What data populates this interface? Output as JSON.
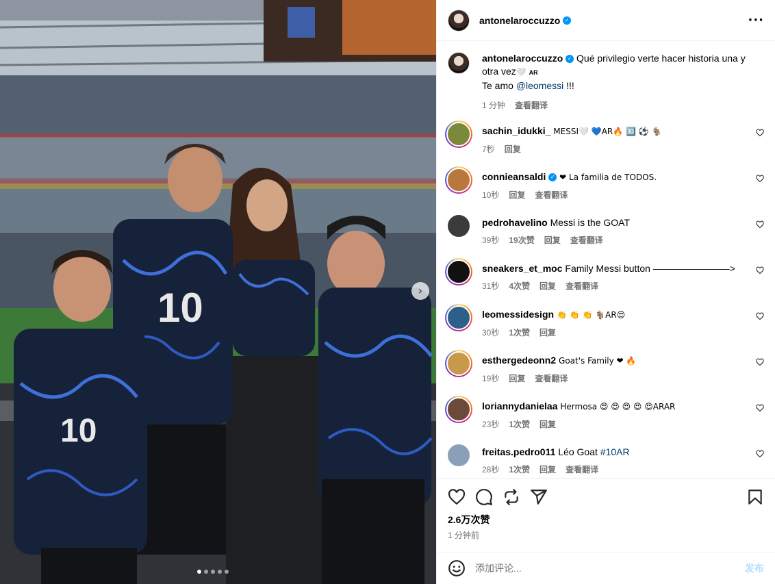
{
  "post": {
    "author": "antonelaroccuzzo",
    "caption_text": "Qué privilegio verte hacer historia una y otra vez",
    "caption_emoji": "🤍",
    "caption_ar": "AR",
    "caption_line2_prefix": "Te amo",
    "caption_mention": "@leomessi",
    "caption_line2_suffix": "!!!",
    "caption_time": "1 分钟",
    "see_translation": "查看翻译",
    "carousel_dots": 5,
    "active_dot": 0
  },
  "comments": [
    {
      "user": "sachin_idukki_",
      "text": "MESSI🤍 💙AR🔥 🔟 ⚽ 🐐",
      "time": "7秒",
      "likes": "",
      "reply": "回复",
      "translate": "",
      "verified": false,
      "avatar_color": "#7a8a3a"
    },
    {
      "user": "connieansaldi",
      "text": "❤ La familia de TODOS.",
      "time": "10秒",
      "likes": "",
      "reply": "回复",
      "translate": "查看翻译",
      "verified": true,
      "avatar_color": "#b8783c"
    },
    {
      "user": "pedrohavelino",
      "text": "Messi is the GOAT",
      "time": "39秒",
      "likes": "19次赞",
      "reply": "回复",
      "translate": "查看翻译",
      "verified": false,
      "avatar_color": "#3b3b3b"
    },
    {
      "user": "sneakers_et_moc",
      "text": "Family Messi button ————————>",
      "time": "31秒",
      "likes": "4次赞",
      "reply": "回复",
      "translate": "查看翻译",
      "verified": false,
      "avatar_color": "#111111"
    },
    {
      "user": "leomessidesign",
      "text": "👏 👏 👏 🐐AR😍",
      "time": "30秒",
      "likes": "1次赞",
      "reply": "回复",
      "translate": "",
      "verified": false,
      "avatar_color": "#2c5f8a"
    },
    {
      "user": "esthergedeonn2",
      "text": "Goat's Family ❤ 🔥",
      "time": "19秒",
      "likes": "",
      "reply": "回复",
      "translate": "查看翻译",
      "verified": false,
      "avatar_color": "#c79a4a"
    },
    {
      "user": "loriannydanielaa",
      "text": "Hermosa 😍 😍 😍 😍 😍ARAR",
      "time": "23秒",
      "likes": "1次赞",
      "reply": "回复",
      "translate": "",
      "verified": false,
      "avatar_color": "#6b4a3a"
    },
    {
      "user": "freitas.pedro011",
      "text": "Léo Goat",
      "hashtag": "#10AR",
      "time": "28秒",
      "likes": "1次赞",
      "reply": "回复",
      "translate": "查看翻译",
      "verified": false,
      "avatar_color": "#8aa0b8"
    }
  ],
  "footer": {
    "likes": "2.6万次赞",
    "time": "1 分钟前",
    "comment_placeholder": "添加评论...",
    "publish": "发布"
  },
  "icons": {
    "more": "more-options-icon",
    "like": "heart-icon",
    "comment": "comment-icon",
    "share": "repost-icon",
    "send": "send-icon",
    "save": "bookmark-icon",
    "emoji": "emoji-icon"
  },
  "colors": {
    "accent": "#0095f6",
    "link": "#00376b",
    "muted": "#737373",
    "divider": "#efefef",
    "publish_disabled": "#b2dffc",
    "jersey": "#16213a"
  }
}
